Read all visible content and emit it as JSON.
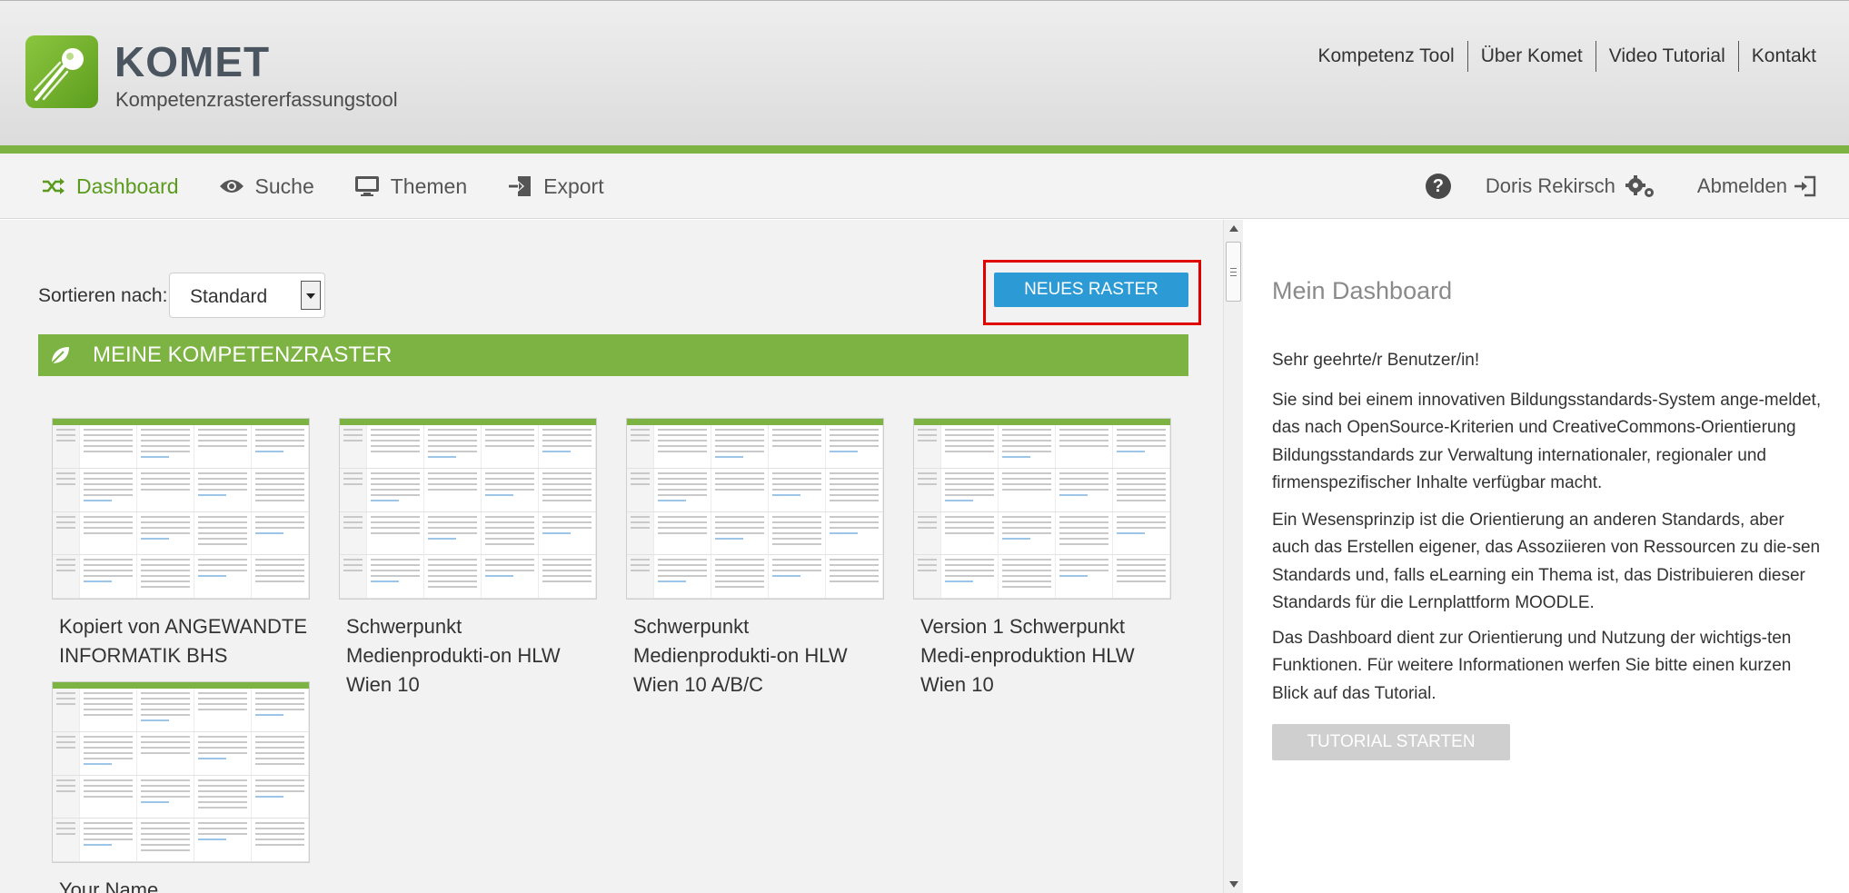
{
  "brand": {
    "title": "KOMET",
    "subtitle": "Kompetenzrastererfassungstool",
    "logo_icon": "comet-icon"
  },
  "topnav": [
    {
      "label": "Kompetenz Tool"
    },
    {
      "label": "Über Komet"
    },
    {
      "label": "Video Tutorial"
    },
    {
      "label": "Kontakt"
    }
  ],
  "subnav": {
    "items": [
      {
        "label": "Dashboard",
        "icon": "shuffle-icon",
        "active": true
      },
      {
        "label": "Suche",
        "icon": "eye-icon"
      },
      {
        "label": "Themen",
        "icon": "monitor-icon"
      },
      {
        "label": "Export",
        "icon": "export-icon"
      }
    ],
    "user_name": "Doris Rekirsch",
    "logout_label": "Abmelden"
  },
  "toolbar": {
    "sort_label": "Sortieren nach:",
    "sort_value": "Standard",
    "new_button": "NEUES RASTER"
  },
  "section": {
    "title": "MEINE KOMPETENZRASTER"
  },
  "cards": [
    {
      "title": "Kopiert von ANGEWANDTE INFORMATIK BHS"
    },
    {
      "title": "Schwerpunkt Medienprodukti-on HLW Wien 10"
    },
    {
      "title": "Schwerpunkt Medienprodukti-on HLW Wien 10 A/B/C"
    },
    {
      "title": "Version 1 Schwerpunkt Medi-enproduktion HLW Wien 10"
    },
    {
      "title": "Your Name"
    }
  ],
  "dashboard": {
    "title": "Mein Dashboard",
    "greeting": "Sehr geehrte/r Benutzer/in!",
    "p1": "Sie sind bei einem innovativen Bildungsstandards-System ange-meldet, das nach OpenSource-Kriterien und CreativeCommons-Orientierung Bildungsstandards zur Verwaltung internationaler, regionaler und firmenspezifischer Inhalte verfügbar macht.",
    "p2": "Ein Wesensprinzip ist die Orientierung an anderen Standards, aber auch das Erstellen eigener, das Assoziieren von Ressourcen zu die-sen Standards und, falls eLearning ein Thema ist, das Distribuieren dieser Standards für die Lernplattform MOODLE.",
    "p3": "Das Dashboard dient zur Orientierung und Nutzung der wichtigs-ten Funktionen. Für weitere Informationen werfen Sie bitte einen kurzen Blick auf das Tutorial.",
    "tutorial_button": "TUTORIAL STARTEN"
  },
  "colors": {
    "brand_green": "#7cb342",
    "button_blue": "#2b9ad5",
    "highlight_red": "#e00000"
  }
}
